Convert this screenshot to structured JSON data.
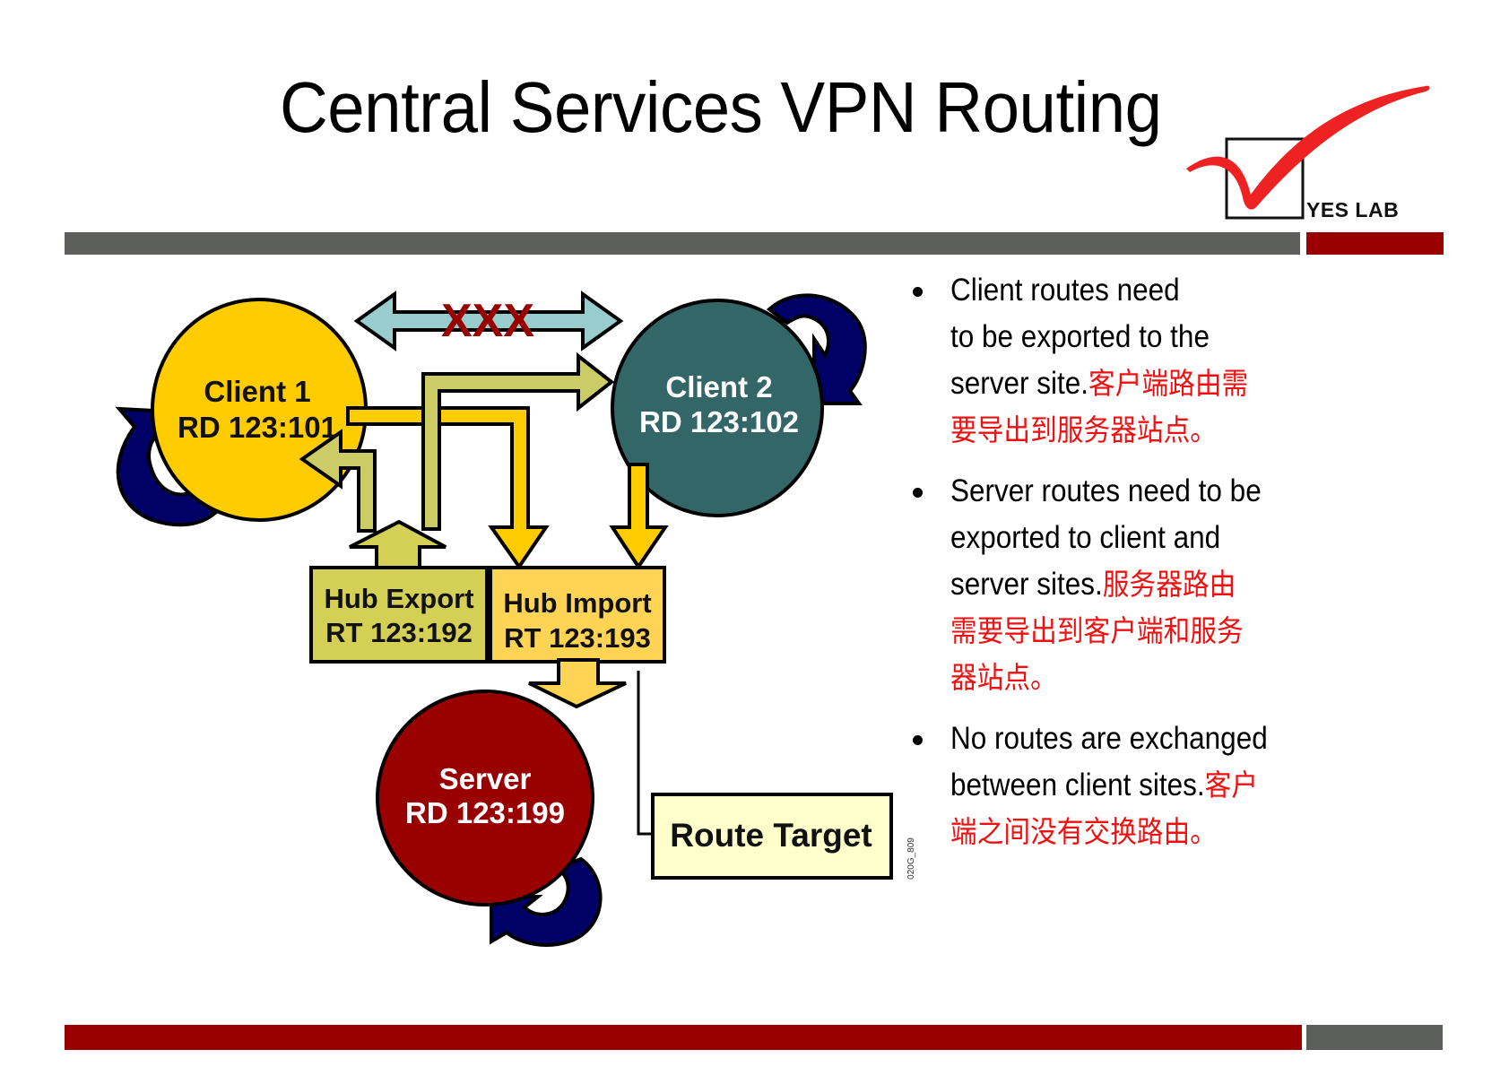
{
  "title": "Central Services VPN Routing",
  "logo": {
    "text": "YES LAB",
    "icon": "checkmark-box-icon",
    "check_color": "#ee2222"
  },
  "colors": {
    "bar_gray": "#5d5f5c",
    "bar_red": "#990000",
    "client1_fill": "#ffcc00",
    "client2_fill": "#336666",
    "server_fill": "#990000",
    "loop_arrow": "#000066",
    "blocked_arrow": "#99cccc",
    "export_arrow": "#cccc66",
    "import_arrow": "#ffcc00",
    "hub_export_fill": "#d4cf55",
    "hub_import_fill": "#ffd455",
    "route_target_fill": "#ffffcc",
    "chinese_text": "#ee1111"
  },
  "diagram": {
    "client1": {
      "name": "Client 1",
      "rd": "RD 123:101"
    },
    "client2": {
      "name": "Client 2",
      "rd": "RD 123:102"
    },
    "server": {
      "name": "Server",
      "rd": "RD 123:199"
    },
    "hub_export": {
      "name": "Hub Export",
      "rt": "RT 123:192"
    },
    "hub_import": {
      "name": "Hub Import",
      "rt": "RT 123:193"
    },
    "blocked_label": "XXX",
    "route_target_label": "Route Target",
    "figure_id": "020G_809"
  },
  "bullets": [
    {
      "lines_en": [
        "Client routes need",
        "to be exported  to the",
        "server  site."
      ],
      "zh_inline": "客户端路由需",
      "lines_zh": [
        "要导出到服务器站点。"
      ]
    },
    {
      "lines_en": [
        "Server  routes need to be",
        "exported to client and",
        "server  sites."
      ],
      "zh_inline": "服务器路由",
      "lines_zh": [
        "需要导出到客户端和服务",
        "器站点。"
      ]
    },
    {
      "lines_en": [
        "No routes are exchanged",
        "between  client sites."
      ],
      "zh_inline": "客户",
      "lines_zh": [
        "端之间没有交换路由。"
      ]
    }
  ]
}
